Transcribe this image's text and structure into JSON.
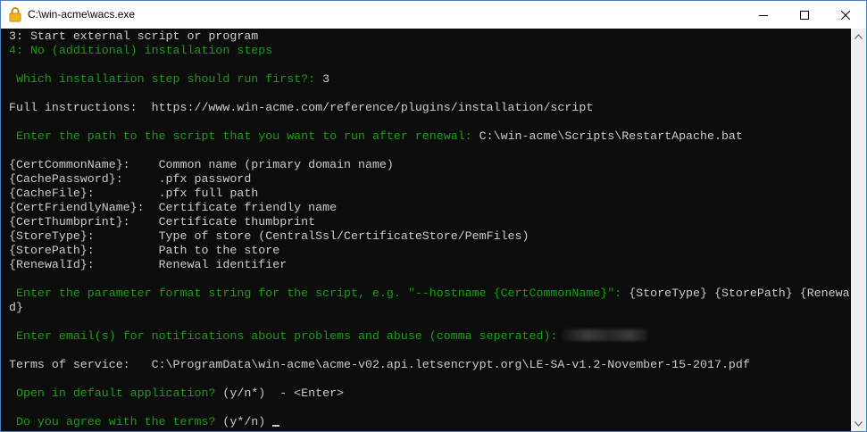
{
  "window": {
    "title": "C:\\win-acme\\wacs.exe",
    "icon": "lock-icon"
  },
  "colors": {
    "background": "#0c0c0c",
    "text": "#cccccc",
    "prompt": "#13a10e",
    "titlebar": "#ffffff"
  },
  "console": {
    "lines": [
      {
        "parts": [
          {
            "t": "3: Start external script or program",
            "c": "w"
          }
        ]
      },
      {
        "parts": [
          {
            "t": "4: No (additional) installation steps",
            "c": "g"
          }
        ]
      },
      {
        "parts": []
      },
      {
        "parts": [
          {
            "t": " Which installation step should run first?: ",
            "c": "g"
          },
          {
            "t": "3",
            "c": "w"
          }
        ]
      },
      {
        "parts": []
      },
      {
        "parts": [
          {
            "t": "Full instructions:  https://www.win-acme.com/reference/plugins/installation/script",
            "c": "w"
          }
        ]
      },
      {
        "parts": []
      },
      {
        "parts": [
          {
            "t": " Enter the path to the script that you want to run after renewal: ",
            "c": "g"
          },
          {
            "t": "C:\\win-acme\\Scripts\\RestartApache.bat",
            "c": "w"
          }
        ]
      },
      {
        "parts": []
      },
      {
        "parts": [
          {
            "t": "{CertCommonName}:    Common name (primary domain name)",
            "c": "w"
          }
        ]
      },
      {
        "parts": [
          {
            "t": "{CachePassword}:     .pfx password",
            "c": "w"
          }
        ]
      },
      {
        "parts": [
          {
            "t": "{CacheFile}:         .pfx full path",
            "c": "w"
          }
        ]
      },
      {
        "parts": [
          {
            "t": "{CertFriendlyName}:  Certificate friendly name",
            "c": "w"
          }
        ]
      },
      {
        "parts": [
          {
            "t": "{CertThumbprint}:    Certificate thumbprint",
            "c": "w"
          }
        ]
      },
      {
        "parts": [
          {
            "t": "{StoreType}:         Type of store (CentralSsl/CertificateStore/PemFiles)",
            "c": "w"
          }
        ]
      },
      {
        "parts": [
          {
            "t": "{StorePath}:         Path to the store",
            "c": "w"
          }
        ]
      },
      {
        "parts": [
          {
            "t": "{RenewalId}:         Renewal identifier",
            "c": "w"
          }
        ]
      },
      {
        "parts": []
      },
      {
        "parts": [
          {
            "t": " Enter the parameter format string for the script, e.g. \"--hostname {CertCommonName}\": ",
            "c": "g"
          },
          {
            "t": "{StoreType} {StorePath} {RenewalI",
            "c": "w"
          }
        ]
      },
      {
        "parts": [
          {
            "t": "d}",
            "c": "w"
          }
        ]
      },
      {
        "parts": []
      },
      {
        "parts": [
          {
            "t": " Enter email(s) for notifications about problems and abuse (comma seperated):",
            "c": "g"
          }
        ],
        "redacted": true
      },
      {
        "parts": []
      },
      {
        "parts": [
          {
            "t": "Terms of service:   C:\\ProgramData\\win-acme\\acme-v02.api.letsencrypt.org\\LE-SA-v1.2-November-15-2017.pdf",
            "c": "w"
          }
        ]
      },
      {
        "parts": []
      },
      {
        "parts": [
          {
            "t": " Open in default application? ",
            "c": "g"
          },
          {
            "t": "(y/n*)  - <Enter>",
            "c": "w"
          }
        ]
      },
      {
        "parts": []
      },
      {
        "parts": [
          {
            "t": " Do you agree with the terms? ",
            "c": "g"
          },
          {
            "t": "(y*/n)",
            "c": "w"
          }
        ],
        "cursor": true
      }
    ]
  }
}
